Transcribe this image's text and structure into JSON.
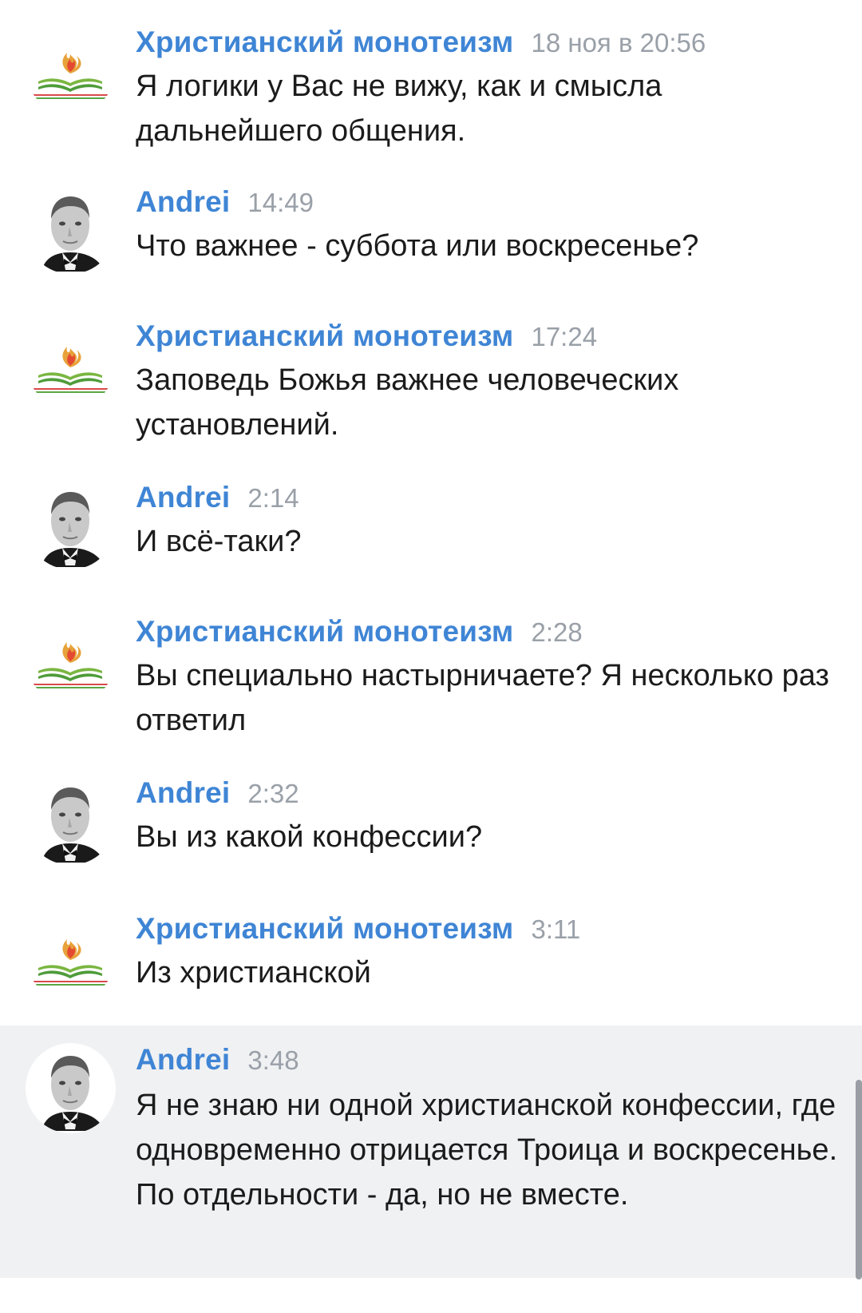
{
  "messages": [
    {
      "author": "Христианский монотеизм",
      "avatar": "book-flame-logo-icon",
      "time": "18 ноя в 20:56",
      "text": "Я логики у Вас не вижу, как и смысла дальнейшего общения."
    },
    {
      "author": "Andrei",
      "avatar": "man-portrait-avatar",
      "time": "14:49",
      "text": "Что важнее - суббота или воскресенье?"
    },
    {
      "author": "Христианский монотеизм",
      "avatar": "book-flame-logo-icon",
      "time": "17:24",
      "text": "Заповедь Божья важнее человеческих установлений."
    },
    {
      "author": "Andrei",
      "avatar": "man-portrait-avatar",
      "time": "2:14",
      "text": "И всё-таки?"
    },
    {
      "author": "Христианский монотеизм",
      "avatar": "book-flame-logo-icon",
      "time": "2:28",
      "text": "Вы специально настырничаете? Я несколько раз ответил"
    },
    {
      "author": "Andrei",
      "avatar": "man-portrait-avatar",
      "time": "2:32",
      "text": "Вы из какой конфессии?"
    },
    {
      "author": "Христианский монотеизм",
      "avatar": "book-flame-logo-icon",
      "time": "3:11",
      "text": "Из христианской"
    },
    {
      "author": "Andrei",
      "avatar": "man-portrait-avatar",
      "time": "3:48",
      "text": "Я не знаю ни одной христианской конфессии, где одновременно отрицается Троица и воскресенье. По отдельности - да, но не вместе.",
      "highlighted": true
    }
  ],
  "colors": {
    "author": "#3f85d5",
    "time": "#9aa0a8",
    "text": "#1b1b1b",
    "highlight_bg": "#f0f1f3"
  }
}
